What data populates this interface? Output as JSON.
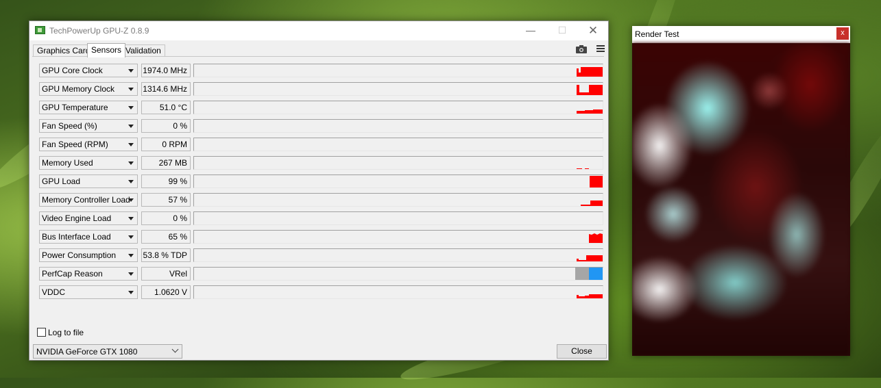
{
  "gpuz": {
    "title": "TechPowerUp GPU-Z 0.8.9",
    "tabs": [
      "Graphics Card",
      "Sensors",
      "Validation"
    ],
    "active_tab": "Sensors",
    "sensors": [
      {
        "name": "GPU Core Clock",
        "value": "1974.0 MHz"
      },
      {
        "name": "GPU Memory Clock",
        "value": "1314.6 MHz"
      },
      {
        "name": "GPU Temperature",
        "value": "51.0 °C"
      },
      {
        "name": "Fan Speed (%)",
        "value": "0 %"
      },
      {
        "name": "Fan Speed (RPM)",
        "value": "0 RPM"
      },
      {
        "name": "Memory Used",
        "value": "267 MB"
      },
      {
        "name": "GPU Load",
        "value": "99 %"
      },
      {
        "name": "Memory Controller Load",
        "value": "57 %"
      },
      {
        "name": "Video Engine Load",
        "value": "0 %"
      },
      {
        "name": "Bus Interface Load",
        "value": "65 %"
      },
      {
        "name": "Power Consumption",
        "value": "53.8 % TDP"
      },
      {
        "name": "PerfCap Reason",
        "value": "VRel"
      },
      {
        "name": "VDDC",
        "value": "1.0620 V"
      }
    ],
    "log_to_file_label": "Log to file",
    "log_to_file_checked": false,
    "gpu_select_value": "NVIDIA GeForce GTX 1080",
    "close_label": "Close",
    "graph_color": "#ff0000",
    "perfcap_colors": [
      "#a6a6a6",
      "#2196f3"
    ]
  },
  "render_test": {
    "title": "Render Test",
    "close_glyph": "x"
  }
}
